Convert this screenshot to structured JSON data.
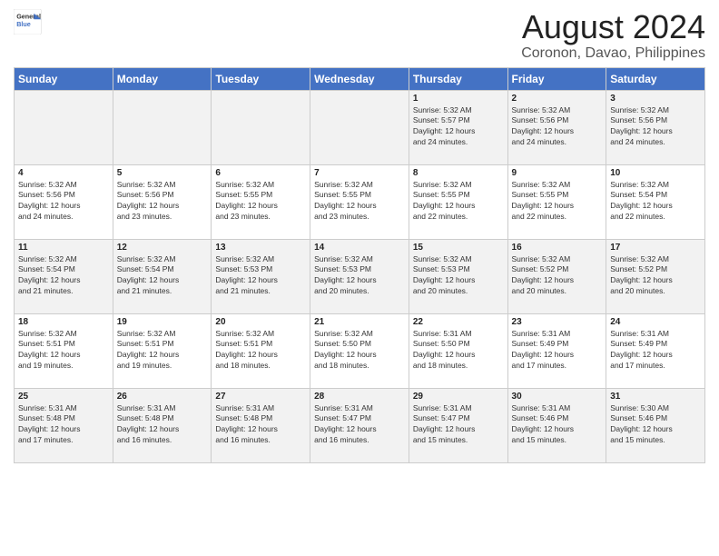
{
  "header": {
    "logo_line1": "General",
    "logo_line2": "Blue",
    "title": "August 2024",
    "subtitle": "Coronon, Davao, Philippines"
  },
  "weekdays": [
    "Sunday",
    "Monday",
    "Tuesday",
    "Wednesday",
    "Thursday",
    "Friday",
    "Saturday"
  ],
  "weeks": [
    [
      {
        "day": "",
        "info": ""
      },
      {
        "day": "",
        "info": ""
      },
      {
        "day": "",
        "info": ""
      },
      {
        "day": "",
        "info": ""
      },
      {
        "day": "1",
        "info": "Sunrise: 5:32 AM\nSunset: 5:57 PM\nDaylight: 12 hours\nand 24 minutes."
      },
      {
        "day": "2",
        "info": "Sunrise: 5:32 AM\nSunset: 5:56 PM\nDaylight: 12 hours\nand 24 minutes."
      },
      {
        "day": "3",
        "info": "Sunrise: 5:32 AM\nSunset: 5:56 PM\nDaylight: 12 hours\nand 24 minutes."
      }
    ],
    [
      {
        "day": "4",
        "info": "Sunrise: 5:32 AM\nSunset: 5:56 PM\nDaylight: 12 hours\nand 24 minutes."
      },
      {
        "day": "5",
        "info": "Sunrise: 5:32 AM\nSunset: 5:56 PM\nDaylight: 12 hours\nand 23 minutes."
      },
      {
        "day": "6",
        "info": "Sunrise: 5:32 AM\nSunset: 5:55 PM\nDaylight: 12 hours\nand 23 minutes."
      },
      {
        "day": "7",
        "info": "Sunrise: 5:32 AM\nSunset: 5:55 PM\nDaylight: 12 hours\nand 23 minutes."
      },
      {
        "day": "8",
        "info": "Sunrise: 5:32 AM\nSunset: 5:55 PM\nDaylight: 12 hours\nand 22 minutes."
      },
      {
        "day": "9",
        "info": "Sunrise: 5:32 AM\nSunset: 5:55 PM\nDaylight: 12 hours\nand 22 minutes."
      },
      {
        "day": "10",
        "info": "Sunrise: 5:32 AM\nSunset: 5:54 PM\nDaylight: 12 hours\nand 22 minutes."
      }
    ],
    [
      {
        "day": "11",
        "info": "Sunrise: 5:32 AM\nSunset: 5:54 PM\nDaylight: 12 hours\nand 21 minutes."
      },
      {
        "day": "12",
        "info": "Sunrise: 5:32 AM\nSunset: 5:54 PM\nDaylight: 12 hours\nand 21 minutes."
      },
      {
        "day": "13",
        "info": "Sunrise: 5:32 AM\nSunset: 5:53 PM\nDaylight: 12 hours\nand 21 minutes."
      },
      {
        "day": "14",
        "info": "Sunrise: 5:32 AM\nSunset: 5:53 PM\nDaylight: 12 hours\nand 20 minutes."
      },
      {
        "day": "15",
        "info": "Sunrise: 5:32 AM\nSunset: 5:53 PM\nDaylight: 12 hours\nand 20 minutes."
      },
      {
        "day": "16",
        "info": "Sunrise: 5:32 AM\nSunset: 5:52 PM\nDaylight: 12 hours\nand 20 minutes."
      },
      {
        "day": "17",
        "info": "Sunrise: 5:32 AM\nSunset: 5:52 PM\nDaylight: 12 hours\nand 20 minutes."
      }
    ],
    [
      {
        "day": "18",
        "info": "Sunrise: 5:32 AM\nSunset: 5:51 PM\nDaylight: 12 hours\nand 19 minutes."
      },
      {
        "day": "19",
        "info": "Sunrise: 5:32 AM\nSunset: 5:51 PM\nDaylight: 12 hours\nand 19 minutes."
      },
      {
        "day": "20",
        "info": "Sunrise: 5:32 AM\nSunset: 5:51 PM\nDaylight: 12 hours\nand 18 minutes."
      },
      {
        "day": "21",
        "info": "Sunrise: 5:32 AM\nSunset: 5:50 PM\nDaylight: 12 hours\nand 18 minutes."
      },
      {
        "day": "22",
        "info": "Sunrise: 5:31 AM\nSunset: 5:50 PM\nDaylight: 12 hours\nand 18 minutes."
      },
      {
        "day": "23",
        "info": "Sunrise: 5:31 AM\nSunset: 5:49 PM\nDaylight: 12 hours\nand 17 minutes."
      },
      {
        "day": "24",
        "info": "Sunrise: 5:31 AM\nSunset: 5:49 PM\nDaylight: 12 hours\nand 17 minutes."
      }
    ],
    [
      {
        "day": "25",
        "info": "Sunrise: 5:31 AM\nSunset: 5:48 PM\nDaylight: 12 hours\nand 17 minutes."
      },
      {
        "day": "26",
        "info": "Sunrise: 5:31 AM\nSunset: 5:48 PM\nDaylight: 12 hours\nand 16 minutes."
      },
      {
        "day": "27",
        "info": "Sunrise: 5:31 AM\nSunset: 5:48 PM\nDaylight: 12 hours\nand 16 minutes."
      },
      {
        "day": "28",
        "info": "Sunrise: 5:31 AM\nSunset: 5:47 PM\nDaylight: 12 hours\nand 16 minutes."
      },
      {
        "day": "29",
        "info": "Sunrise: 5:31 AM\nSunset: 5:47 PM\nDaylight: 12 hours\nand 15 minutes."
      },
      {
        "day": "30",
        "info": "Sunrise: 5:31 AM\nSunset: 5:46 PM\nDaylight: 12 hours\nand 15 minutes."
      },
      {
        "day": "31",
        "info": "Sunrise: 5:30 AM\nSunset: 5:46 PM\nDaylight: 12 hours\nand 15 minutes."
      }
    ]
  ]
}
